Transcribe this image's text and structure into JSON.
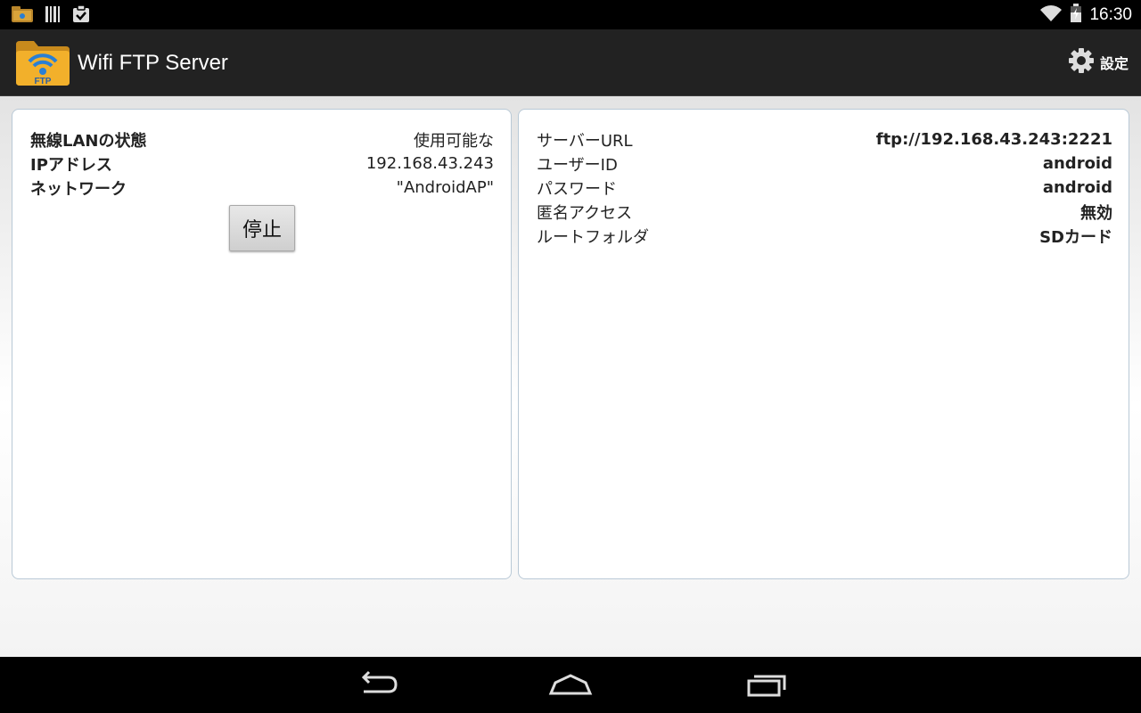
{
  "status_bar": {
    "time": "16:30",
    "icons": [
      "ftp-folder-notification-icon",
      "barcode-icon",
      "task-check-icon",
      "wifi-icon",
      "battery-icon"
    ]
  },
  "action_bar": {
    "title": "Wifi FTP Server",
    "app_icon_text": "FTP",
    "settings_label": "設定"
  },
  "wlan_card": {
    "rows": [
      {
        "label": "無線LANの状態",
        "value": "使用可能な"
      },
      {
        "label": "IPアドレス",
        "value": "192.168.43.243"
      },
      {
        "label": "ネットワーク",
        "value": "\"AndroidAP\""
      }
    ],
    "stop_button": "停止"
  },
  "server_card": {
    "rows": [
      {
        "label": "サーバーURL",
        "value": "ftp://192.168.43.243:2221"
      },
      {
        "label": "ユーザーID",
        "value": "android"
      },
      {
        "label": "パスワード",
        "value": "android"
      },
      {
        "label": "匿名アクセス",
        "value": "無効"
      },
      {
        "label": "ルートフォルダ",
        "value": "SDカード"
      }
    ]
  },
  "nav_bar": {
    "buttons": [
      "back-icon",
      "home-icon",
      "recent-apps-icon"
    ]
  },
  "colors": {
    "action_bar": "#222222",
    "card_border": "#b9c9d6",
    "folder": "#f2b02b",
    "wifi_blue": "#2a7fd4"
  }
}
